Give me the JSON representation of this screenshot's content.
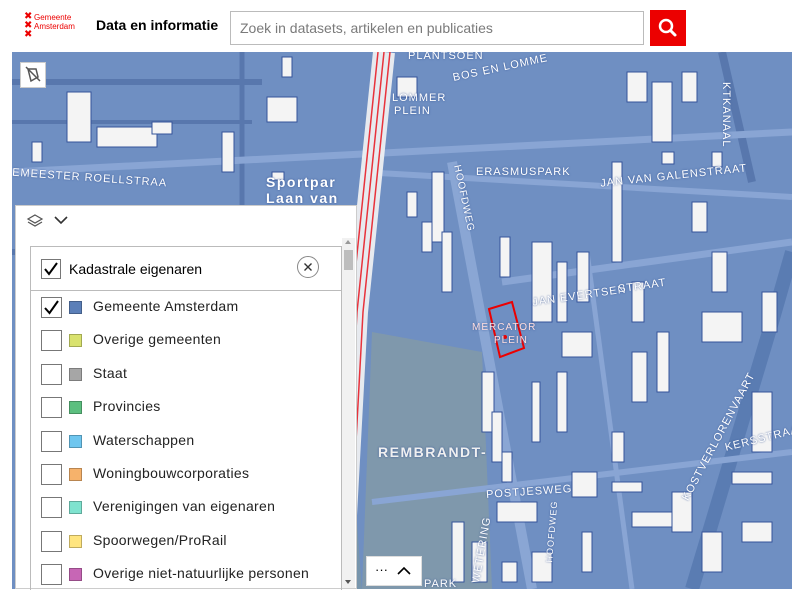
{
  "header": {
    "logo_lines": [
      "Gemeente",
      "Amsterdam"
    ],
    "site_title": "Data en informatie",
    "search_placeholder": "Zoek in datasets, artikelen en publicaties"
  },
  "map": {
    "labels": {
      "plantsoen": "PLANTSOEN",
      "bos_en_lommer_1": "BOS EN LOMME",
      "lommer": "LOMMER",
      "plein": "PLEIN",
      "roell": "EMEESTER ROELLSTRAA",
      "sportpark_1": "Sportpar",
      "sportpark_2": "Laan van",
      "erasmuspark": "ERASMUSPARK",
      "galen": "JAN VAN GALENSTRAAT",
      "kanaal": "KTKANAAL",
      "hoofdweg": "HOOFDWEG",
      "evertsen": "JAN EVERTSEN",
      "straat": "STRAAT",
      "mercator_1": "MERCATOR",
      "mercator_2": "PLEIN",
      "rembrandt": "REMBRANDT-",
      "postjesweg": "POSTJESWEG",
      "kostverloren": "KOSTVERLORENVAART",
      "ersstraat": "KERSSTRAAT",
      "wetering": "WETERING",
      "hoofdweg2": "HOOFDWEG",
      "park": "PARK"
    },
    "expand_dots": "···"
  },
  "legend": {
    "layer_title": "Kadastrale eigenaren",
    "layer_checked": true,
    "items": [
      {
        "label": "Gemeente Amsterdam",
        "color": "#5b7fb8",
        "checked": true
      },
      {
        "label": "Overige gemeenten",
        "color": "#d9e26e",
        "checked": false
      },
      {
        "label": "Staat",
        "color": "#a6a6a6",
        "checked": false
      },
      {
        "label": "Provincies",
        "color": "#5cbf7f",
        "checked": false
      },
      {
        "label": "Waterschappen",
        "color": "#6ec6ef",
        "checked": false
      },
      {
        "label": "Woningbouwcorporaties",
        "color": "#f6b26b",
        "checked": false
      },
      {
        "label": "Verenigingen van eigenaren",
        "color": "#7fe3cf",
        "checked": false
      },
      {
        "label": "Spoorwegen/ProRail",
        "color": "#ffe57f",
        "checked": false
      },
      {
        "label": "Overige niet-natuurlijke personen",
        "color": "#c766b5",
        "checked": false
      }
    ]
  }
}
